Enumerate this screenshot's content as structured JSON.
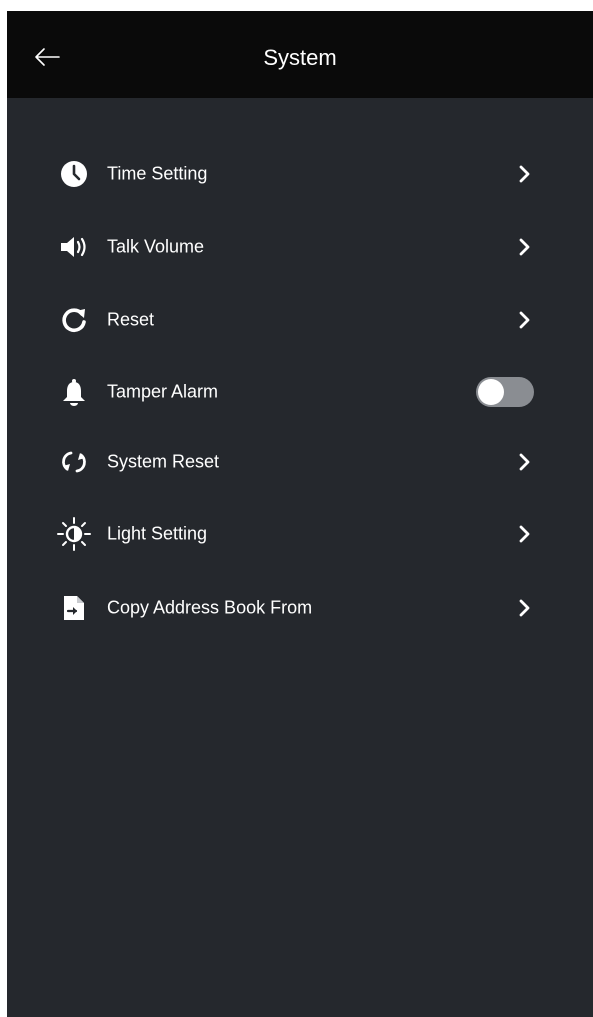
{
  "header": {
    "title": "System",
    "back_icon": "arrow-left-icon"
  },
  "menu": {
    "items": [
      {
        "label": "Time Setting",
        "icon": "clock-icon",
        "control": "chevron"
      },
      {
        "label": "Talk Volume",
        "icon": "speaker-icon",
        "control": "chevron"
      },
      {
        "label": "Reset",
        "icon": "refresh-icon",
        "control": "chevron"
      },
      {
        "label": "Tamper Alarm",
        "icon": "bell-icon",
        "control": "toggle",
        "toggle_on": false
      },
      {
        "label": "System Reset",
        "icon": "sync-icon",
        "control": "chevron"
      },
      {
        "label": "Light Setting",
        "icon": "sun-icon",
        "control": "chevron"
      },
      {
        "label": "Copy Address Book From",
        "icon": "file-import-icon",
        "control": "chevron"
      }
    ]
  },
  "colors": {
    "background": "#25282d",
    "header": "#0a0a0a",
    "text": "#ffffff",
    "toggle_off": "#8a8d92"
  }
}
